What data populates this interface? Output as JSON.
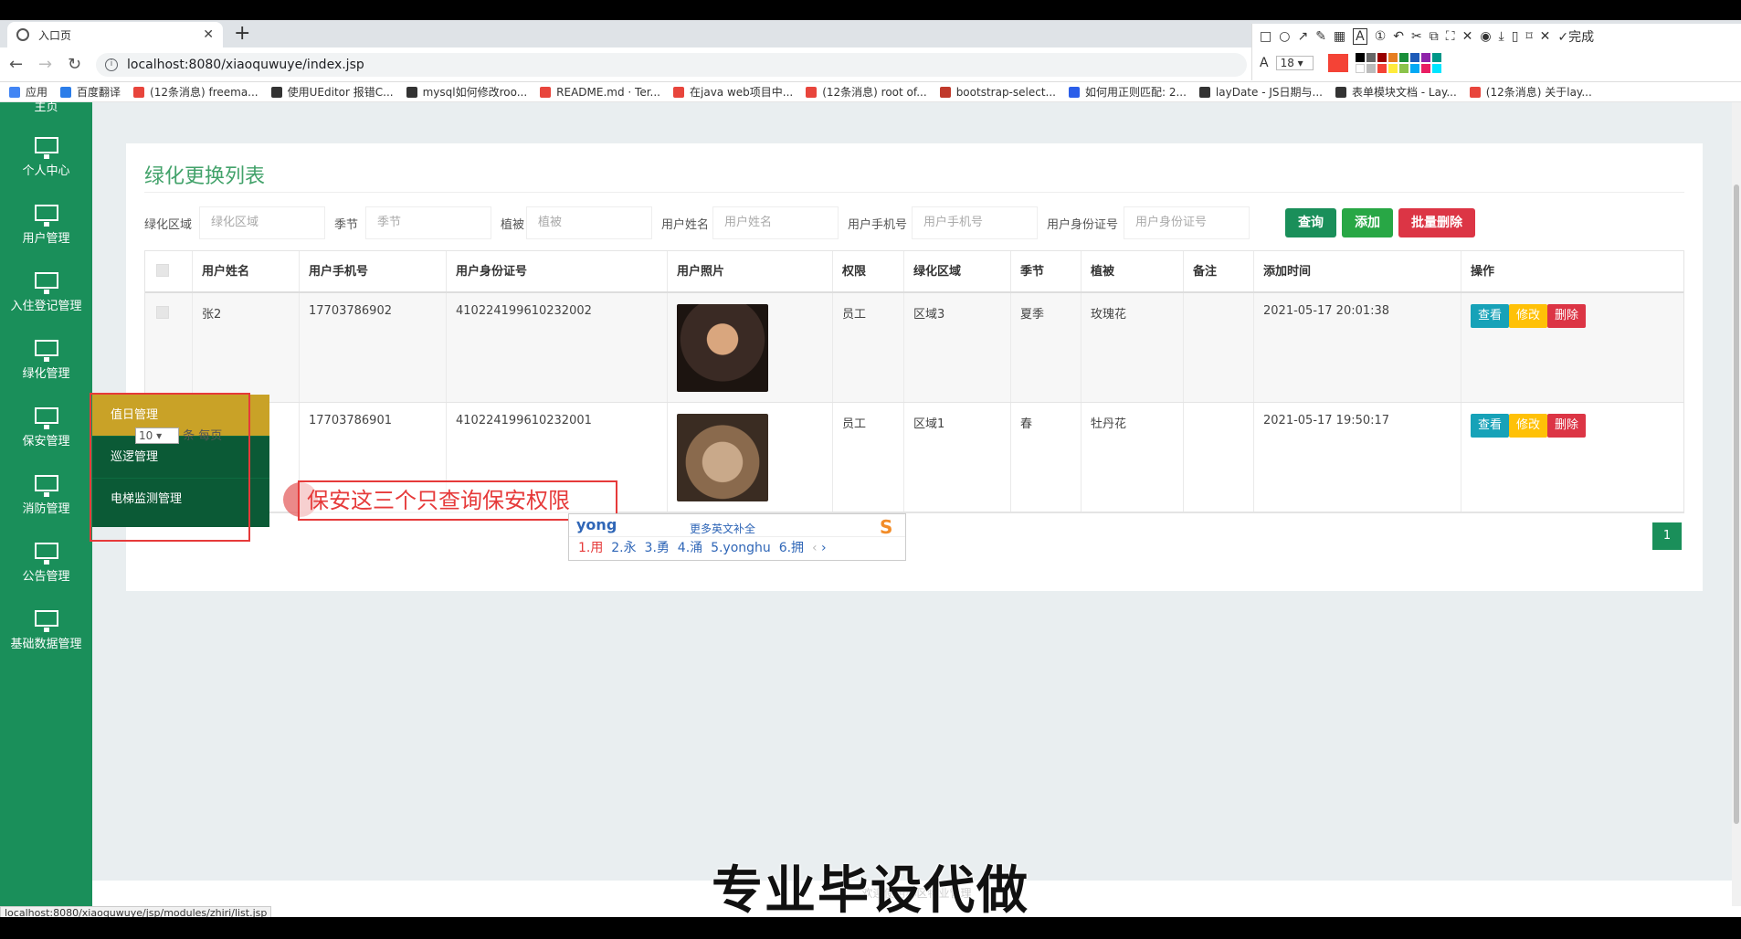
{
  "browser": {
    "tab_title": "入口页",
    "url": "localhost:8080/xiaoquwuye/index.jsp",
    "bookmarks": [
      "应用",
      "百度翻译",
      "(12条消息) freema...",
      "使用UEditor 报错C...",
      "mysql如何修改roo...",
      "README.md · Ter...",
      "在java web项目中...",
      "(12条消息) root of...",
      "bootstrap-select...",
      "如何用正则匹配: 2...",
      "layDate - JS日期与...",
      "表单模块文档 - Lay...",
      "(12条消息) 关于lay..."
    ],
    "status_url": "localhost:8080/xiaoquwuye/jsp/modules/zhiri/list.jsp"
  },
  "annot_toolbar": {
    "font_size": "18",
    "done_label": "完成",
    "current_color": "#f44336"
  },
  "sidebar": {
    "top_partial": "主页",
    "items": [
      "个人中心",
      "用户管理",
      "入住登记管理",
      "绿化管理",
      "保安管理",
      "消防管理",
      "公告管理",
      "基础数据管理"
    ],
    "submenu": [
      "值日管理",
      "巡逻管理",
      "电梯监测管理"
    ]
  },
  "page": {
    "title": "绿化更换列表",
    "search": {
      "labels": [
        "绿化区域",
        "季节",
        "植被",
        "用户姓名",
        "用户手机号",
        "用户身份证号"
      ],
      "placeholders": [
        "绿化区域",
        "季节",
        "植被",
        "用户姓名",
        "用户手机号",
        "用户身份证号"
      ],
      "btn_query": "查询",
      "btn_add": "添加",
      "btn_batch_delete": "批量删除"
    },
    "table": {
      "headers": [
        "用户姓名",
        "用户手机号",
        "用户身份证号",
        "用户照片",
        "权限",
        "绿化区域",
        "季节",
        "植被",
        "备注",
        "添加时间",
        "操作"
      ],
      "rows": [
        {
          "name": "张2",
          "phone": "17703786902",
          "idcard": "410224199610232002",
          "role": "员工",
          "area": "区域3",
          "season": "夏季",
          "plant": "玫瑰花",
          "note": "",
          "time": "2021-05-17 20:01:38"
        },
        {
          "name": "",
          "phone": "17703786901",
          "idcard": "410224199610232001",
          "role": "员工",
          "area": "区域1",
          "season": "春",
          "plant": "牡丹花",
          "note": "",
          "time": "2021-05-17 19:50:17"
        }
      ],
      "actions": {
        "view": "查看",
        "edit": "修改",
        "delete": "删除"
      }
    },
    "pager": {
      "current": "1",
      "page_size": "10",
      "page_size_suffix": "条 每页"
    },
    "footer": "欢迎使用小区物业管理"
  },
  "overlay": {
    "annotation_text": "保安这三个只查询保安权限",
    "ime": {
      "input": "yong",
      "more": "更多英文补全",
      "candidates": [
        "1.用",
        "2.永",
        "3.勇",
        "4.涌",
        "5.yonghu",
        "6.拥"
      ]
    },
    "subtitle": "专业毕设代做"
  },
  "colors": {
    "sidebar": "#1a8f5a",
    "title": "#42a26a",
    "query": "#1a8f5a",
    "add": "#28a745",
    "batch_delete": "#dc3545",
    "view": "#17a2b8",
    "edit": "#ffc107",
    "delete": "#dc3545",
    "submenu_active": "#c9a227"
  }
}
